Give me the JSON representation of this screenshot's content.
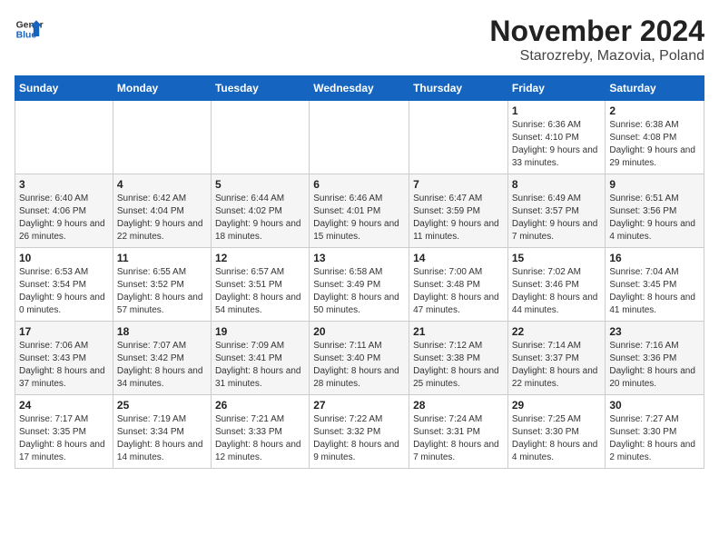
{
  "header": {
    "logo_line1": "General",
    "logo_line2": "Blue",
    "month_year": "November 2024",
    "location": "Starozreby, Mazovia, Poland"
  },
  "days_of_week": [
    "Sunday",
    "Monday",
    "Tuesday",
    "Wednesday",
    "Thursday",
    "Friday",
    "Saturday"
  ],
  "weeks": [
    [
      {
        "day": "",
        "info": ""
      },
      {
        "day": "",
        "info": ""
      },
      {
        "day": "",
        "info": ""
      },
      {
        "day": "",
        "info": ""
      },
      {
        "day": "",
        "info": ""
      },
      {
        "day": "1",
        "info": "Sunrise: 6:36 AM\nSunset: 4:10 PM\nDaylight: 9 hours and 33 minutes."
      },
      {
        "day": "2",
        "info": "Sunrise: 6:38 AM\nSunset: 4:08 PM\nDaylight: 9 hours and 29 minutes."
      }
    ],
    [
      {
        "day": "3",
        "info": "Sunrise: 6:40 AM\nSunset: 4:06 PM\nDaylight: 9 hours and 26 minutes."
      },
      {
        "day": "4",
        "info": "Sunrise: 6:42 AM\nSunset: 4:04 PM\nDaylight: 9 hours and 22 minutes."
      },
      {
        "day": "5",
        "info": "Sunrise: 6:44 AM\nSunset: 4:02 PM\nDaylight: 9 hours and 18 minutes."
      },
      {
        "day": "6",
        "info": "Sunrise: 6:46 AM\nSunset: 4:01 PM\nDaylight: 9 hours and 15 minutes."
      },
      {
        "day": "7",
        "info": "Sunrise: 6:47 AM\nSunset: 3:59 PM\nDaylight: 9 hours and 11 minutes."
      },
      {
        "day": "8",
        "info": "Sunrise: 6:49 AM\nSunset: 3:57 PM\nDaylight: 9 hours and 7 minutes."
      },
      {
        "day": "9",
        "info": "Sunrise: 6:51 AM\nSunset: 3:56 PM\nDaylight: 9 hours and 4 minutes."
      }
    ],
    [
      {
        "day": "10",
        "info": "Sunrise: 6:53 AM\nSunset: 3:54 PM\nDaylight: 9 hours and 0 minutes."
      },
      {
        "day": "11",
        "info": "Sunrise: 6:55 AM\nSunset: 3:52 PM\nDaylight: 8 hours and 57 minutes."
      },
      {
        "day": "12",
        "info": "Sunrise: 6:57 AM\nSunset: 3:51 PM\nDaylight: 8 hours and 54 minutes."
      },
      {
        "day": "13",
        "info": "Sunrise: 6:58 AM\nSunset: 3:49 PM\nDaylight: 8 hours and 50 minutes."
      },
      {
        "day": "14",
        "info": "Sunrise: 7:00 AM\nSunset: 3:48 PM\nDaylight: 8 hours and 47 minutes."
      },
      {
        "day": "15",
        "info": "Sunrise: 7:02 AM\nSunset: 3:46 PM\nDaylight: 8 hours and 44 minutes."
      },
      {
        "day": "16",
        "info": "Sunrise: 7:04 AM\nSunset: 3:45 PM\nDaylight: 8 hours and 41 minutes."
      }
    ],
    [
      {
        "day": "17",
        "info": "Sunrise: 7:06 AM\nSunset: 3:43 PM\nDaylight: 8 hours and 37 minutes."
      },
      {
        "day": "18",
        "info": "Sunrise: 7:07 AM\nSunset: 3:42 PM\nDaylight: 8 hours and 34 minutes."
      },
      {
        "day": "19",
        "info": "Sunrise: 7:09 AM\nSunset: 3:41 PM\nDaylight: 8 hours and 31 minutes."
      },
      {
        "day": "20",
        "info": "Sunrise: 7:11 AM\nSunset: 3:40 PM\nDaylight: 8 hours and 28 minutes."
      },
      {
        "day": "21",
        "info": "Sunrise: 7:12 AM\nSunset: 3:38 PM\nDaylight: 8 hours and 25 minutes."
      },
      {
        "day": "22",
        "info": "Sunrise: 7:14 AM\nSunset: 3:37 PM\nDaylight: 8 hours and 22 minutes."
      },
      {
        "day": "23",
        "info": "Sunrise: 7:16 AM\nSunset: 3:36 PM\nDaylight: 8 hours and 20 minutes."
      }
    ],
    [
      {
        "day": "24",
        "info": "Sunrise: 7:17 AM\nSunset: 3:35 PM\nDaylight: 8 hours and 17 minutes."
      },
      {
        "day": "25",
        "info": "Sunrise: 7:19 AM\nSunset: 3:34 PM\nDaylight: 8 hours and 14 minutes."
      },
      {
        "day": "26",
        "info": "Sunrise: 7:21 AM\nSunset: 3:33 PM\nDaylight: 8 hours and 12 minutes."
      },
      {
        "day": "27",
        "info": "Sunrise: 7:22 AM\nSunset: 3:32 PM\nDaylight: 8 hours and 9 minutes."
      },
      {
        "day": "28",
        "info": "Sunrise: 7:24 AM\nSunset: 3:31 PM\nDaylight: 8 hours and 7 minutes."
      },
      {
        "day": "29",
        "info": "Sunrise: 7:25 AM\nSunset: 3:30 PM\nDaylight: 8 hours and 4 minutes."
      },
      {
        "day": "30",
        "info": "Sunrise: 7:27 AM\nSunset: 3:30 PM\nDaylight: 8 hours and 2 minutes."
      }
    ]
  ]
}
